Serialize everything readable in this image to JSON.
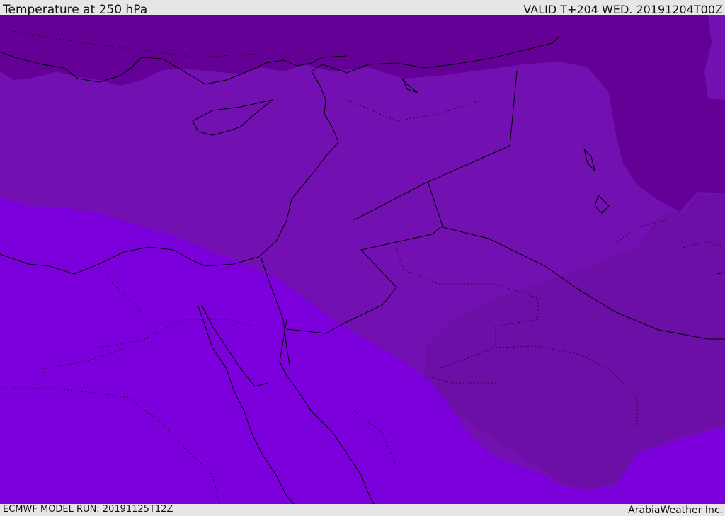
{
  "header": {
    "title": "Temperature at 250 hPa",
    "valid": "VALID T+204 WED. 20191204T00Z"
  },
  "footer": {
    "model_run": "ECMWF MODEL RUN: 20191125T12Z",
    "credit": "ArabiaWeather Inc."
  },
  "map": {
    "colors": {
      "darkest": "#650096",
      "dark": "#7210b2",
      "medium": "#6c0fa7",
      "light": "#7c00dc",
      "coast": "#000000"
    }
  }
}
